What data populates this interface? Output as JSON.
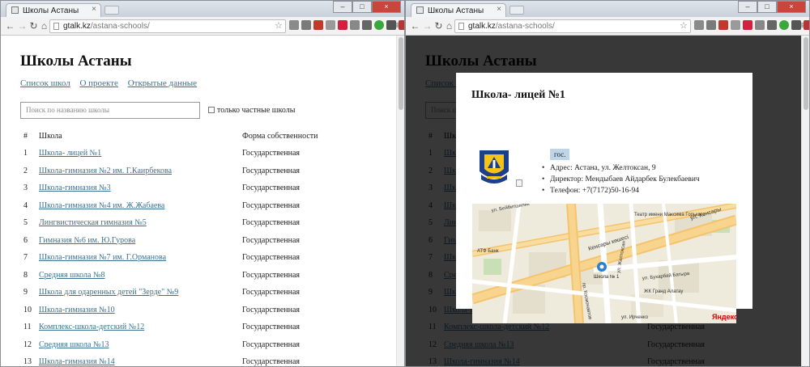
{
  "browser": {
    "tab_title": "Школы Астаны",
    "url_domain": "gtalk.kz",
    "url_path": "/astana-schools/"
  },
  "page": {
    "title": "Школы Астаны",
    "nav": [
      "Список школ",
      "О проекте",
      "Открытые данные"
    ],
    "search_placeholder": "Поиск по названию школы",
    "private_only_label": "только частные школы",
    "table": {
      "headers": [
        "#",
        "Школа",
        "Форма собственности"
      ],
      "rows": [
        {
          "n": "1",
          "name": "Школа- лицей №1",
          "own": "Государственная"
        },
        {
          "n": "2",
          "name": "Школа-гимназия №2 им. Г.Каирбекова",
          "own": "Государственная"
        },
        {
          "n": "3",
          "name": "Школа-гимназия №3",
          "own": "Государственная"
        },
        {
          "n": "4",
          "name": "Школа-гимназия №4 им. Ж.Жабаева",
          "own": "Государственная"
        },
        {
          "n": "5",
          "name": "Лингвистическая гимназия №5",
          "own": "Государственная"
        },
        {
          "n": "6",
          "name": "Гимназия №6 им. Ю.Гурова",
          "own": "Государственная"
        },
        {
          "n": "7",
          "name": "Школа-гимназия №7 им. Г.Орманова",
          "own": "Государственная"
        },
        {
          "n": "8",
          "name": "Средняя школа №8",
          "own": "Государственная"
        },
        {
          "n": "9",
          "name": "Школа для одаренных детей \"Зерде\" №9",
          "own": "Государственная"
        },
        {
          "n": "10",
          "name": "Школа-гимназия №10",
          "own": "Государственная"
        },
        {
          "n": "11",
          "name": "Комплекс-школа-детский №12",
          "own": "Государственная"
        },
        {
          "n": "12",
          "name": "Средняя школа №13",
          "own": "Государственная"
        },
        {
          "n": "13",
          "name": "Школа-гимназия №14",
          "own": "Государственная"
        }
      ]
    }
  },
  "modal": {
    "title": "Школа- лицей №1",
    "badge": "гос.",
    "address": "Адрес: Астана, ул. Желтоксан, 9",
    "director": "Директор: Мендыбаев Айдарбек Булекбаевич",
    "phone": "Телефон: +7(7172)50-16-94",
    "map": {
      "street_beibitshilik": "ул. Бейбитшилик",
      "street_kensary": "ул. Кенсары",
      "street_kensary_kz": "Кенсары көшесі",
      "street_zheltoksan": "ул. Желтоксан",
      "street_bukharbay": "ул. Бухарбай Батыра",
      "street_kosmonavtov": "пр. Космонавтов",
      "street_irchenko": "ул. Ирченко",
      "theatre": "Театр имени Максима Горького",
      "marker_label": "Школа № 1",
      "complex": "ЖК Гранд Алатау",
      "bank": "АТФ Банк",
      "logo": "Яндекс"
    }
  },
  "colors": {
    "link": "#3a7191",
    "badge": "#bdd5e7"
  }
}
